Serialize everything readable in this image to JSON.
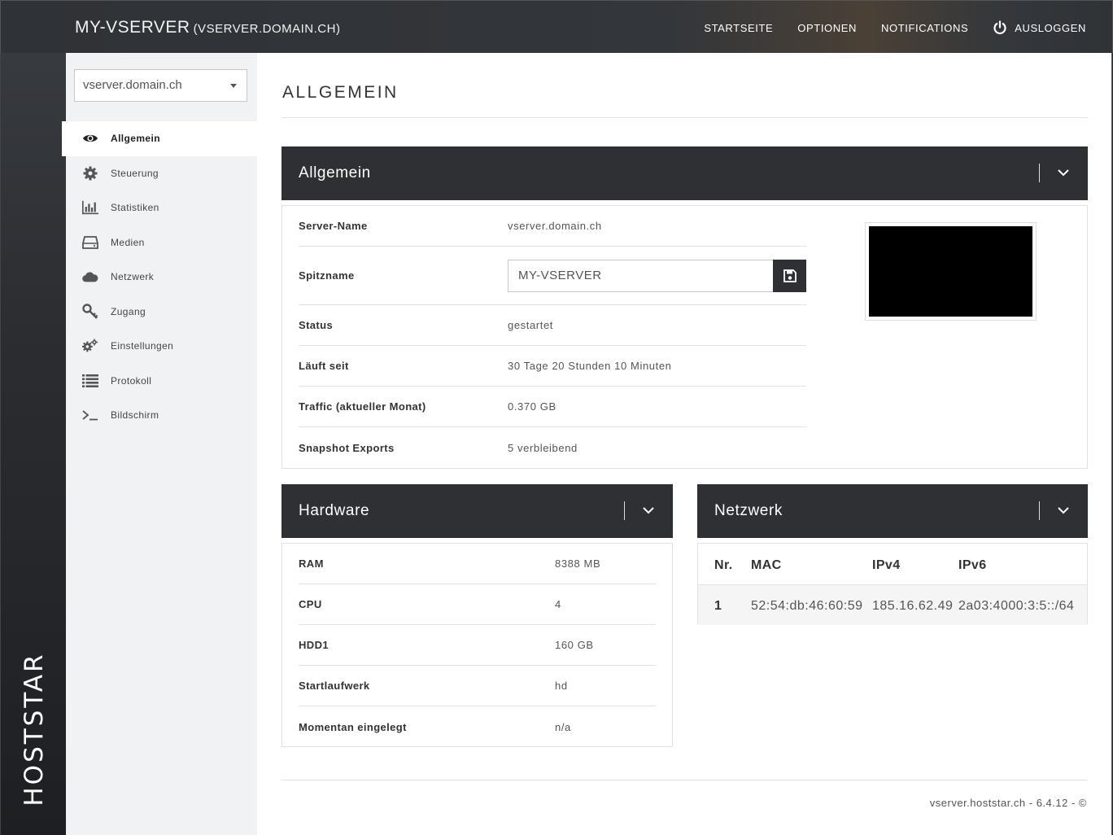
{
  "brand": "HOSTSTAR",
  "header": {
    "title": "MY-VSERVER",
    "subtitle": "(VSERVER.DOMAIN.CH)",
    "nav": [
      "STARTSEITE",
      "OPTIONEN",
      "NOTIFICATIONS",
      "AUSLOGGEN"
    ]
  },
  "sidebar": {
    "selected_server": "vserver.domain.ch",
    "items": [
      {
        "label": "Allgemein",
        "icon": "eye-icon",
        "active": true
      },
      {
        "label": "Steuerung",
        "icon": "gear-icon"
      },
      {
        "label": "Statistiken",
        "icon": "bar-chart-icon"
      },
      {
        "label": "Medien",
        "icon": "hard-drive-icon"
      },
      {
        "label": "Netzwerk",
        "icon": "cloud-icon"
      },
      {
        "label": "Zugang",
        "icon": "key-icon"
      },
      {
        "label": "Einstellungen",
        "icon": "gears-icon"
      },
      {
        "label": "Protokoll",
        "icon": "list-icon"
      },
      {
        "label": "Bildschirm",
        "icon": "terminal-icon"
      }
    ]
  },
  "page_title": "ALLGEMEIN",
  "general": {
    "title": "Allgemein",
    "server_name_label": "Server-Name",
    "server_name": "vserver.domain.ch",
    "nickname_label": "Spitzname",
    "nickname": "MY-VSERVER",
    "status_label": "Status",
    "status": "gestartet",
    "uptime_label": "Läuft seit",
    "uptime": "30 Tage 20 Stunden 10 Minuten",
    "traffic_label": "Traffic (aktueller Monat)",
    "traffic": "0.370 GB",
    "snapshot_label": "Snapshot Exports",
    "snapshot": "5 verbleibend"
  },
  "hardware": {
    "title": "Hardware",
    "rows": [
      {
        "label": "RAM",
        "value": "8388 MB"
      },
      {
        "label": "CPU",
        "value": "4"
      },
      {
        "label": "HDD1",
        "value": "160 GB"
      },
      {
        "label": "Startlaufwerk",
        "value": "hd"
      },
      {
        "label": "Momentan eingelegt",
        "value": "n/a"
      }
    ]
  },
  "network": {
    "title": "Netzwerk",
    "columns": [
      "Nr.",
      "MAC",
      "IPv4",
      "IPv6"
    ],
    "rows": [
      {
        "nr": "1",
        "mac": "52:54:db:46:60:59",
        "ipv4": "185.16.62.49",
        "ipv6": "2a03:4000:3:5::/64"
      }
    ]
  },
  "footer": "vserver.hoststar.ch - 6.4.12 - ©"
}
